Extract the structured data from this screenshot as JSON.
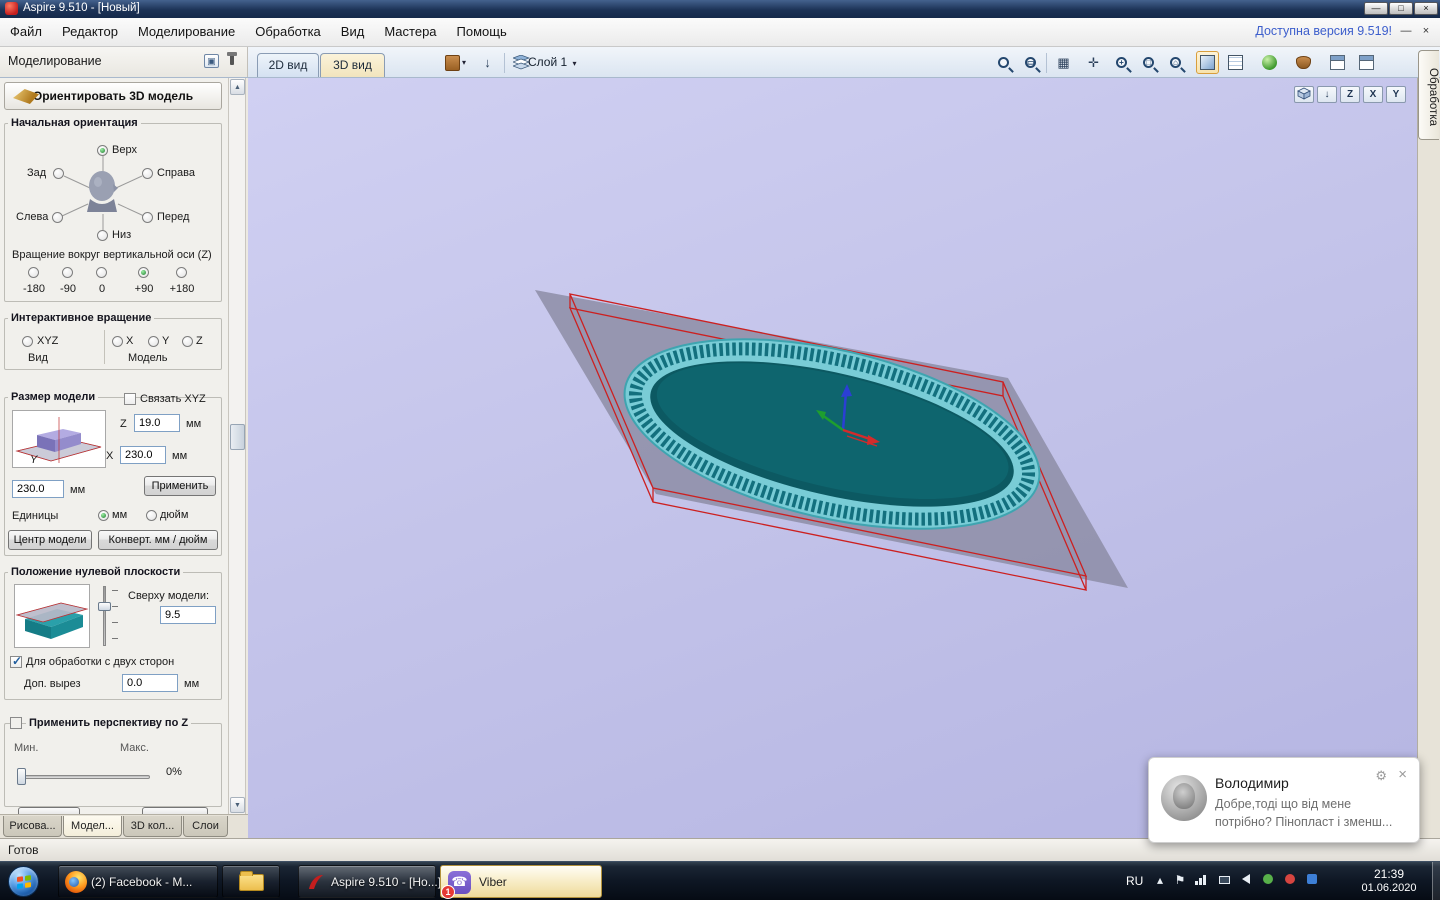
{
  "icons": {
    "minimize": "—",
    "maximize": "□",
    "close": "×",
    "dropdown": "▾",
    "scroll_up": "▲",
    "scroll_down": "▼",
    "grid": "▦",
    "pan": "✛",
    "down_arrow": "↓",
    "gear": "⚙",
    "phone": "☎",
    "flag": "⚑",
    "chevron_up": "▴"
  },
  "titlebar": {
    "title": "Aspire 9.510 - [Новый]"
  },
  "menubar": {
    "items": [
      "Файл",
      "Редактор",
      "Моделирование",
      "Обработка",
      "Вид",
      "Мастера",
      "Помощь"
    ],
    "update_notice": "Доступна версия 9.519!"
  },
  "toolbar": {
    "panel_title": "Моделирование",
    "tab_2d": "2D вид",
    "tab_3d": "3D вид",
    "layer_label": "Слой 1"
  },
  "viewport": {
    "axis_z": "Z",
    "axis_x": "X",
    "axis_y": "Y"
  },
  "right_dock": {
    "tab": "Обработка"
  },
  "panel": {
    "orient_button": "Ориентировать 3D модель",
    "orientation": {
      "title": "Начальная ориентация",
      "top": "Верх",
      "back": "Зад",
      "right": "Справа",
      "left": "Слева",
      "front": "Перед",
      "bottom": "Низ",
      "selected": "Верх",
      "rotation_label": "Вращение вокруг вертикальной оси (Z)",
      "angles": [
        "-180",
        "-90",
        "0",
        "+90",
        "+180"
      ],
      "selected_angle": "+90"
    },
    "interactive": {
      "title": "Интерактивное вращение",
      "xyz": "XYZ",
      "x": "X",
      "y": "Y",
      "z": "Z",
      "view": "Вид",
      "model": "Модель"
    },
    "size": {
      "title": "Размер модели",
      "link": "Связать XYZ",
      "z": "Z",
      "x": "X",
      "y": "Y",
      "z_value": "19.0",
      "x_value": "230.0",
      "y_value": "230.0",
      "mm": "мм",
      "apply": "Применить",
      "units": "Единицы",
      "unit_mm": "мм",
      "unit_inch": "дюйм",
      "selected_unit": "мм",
      "center": "Центр модели",
      "convert": "Конверт. мм / дюйм"
    },
    "zero_plane": {
      "title": "Положение нулевой плоскости",
      "above": "Сверху модели:",
      "above_value": "9.5",
      "two_sided": "Для обработки с двух сторон",
      "two_sided_checked": true,
      "gap": "Доп. вырез",
      "gap_value": "0.0",
      "mm": "мм"
    },
    "perspective": {
      "title": "Применить перспективу по Z",
      "min": "Мин.",
      "max": "Макс.",
      "value": "0%"
    }
  },
  "bottom_tabs": [
    "Рисова...",
    "Модел...",
    "3D кол...",
    "Слои"
  ],
  "statusbar": {
    "ready": "Готов"
  },
  "taskbar": {
    "firefox": "(2) Facebook - M...",
    "aspire": "Aspire 9.510 - [Но...]",
    "viber": "Viber",
    "viber_badge": "1",
    "language": "RU",
    "time": "21:39",
    "date": "01.06.2020"
  },
  "notification": {
    "name": "Володимир",
    "message": "Добре,тоді що від мене потрібно? Пінопласт і зменш..."
  },
  "colors": {
    "viewport_bg": "#c4c4ea",
    "dish_rim": "#79ccd6",
    "dish_center": "#0c5962",
    "plane": "#8d8da6",
    "wire_red": "#cc2020",
    "active_tab": "#f2e4bd"
  }
}
